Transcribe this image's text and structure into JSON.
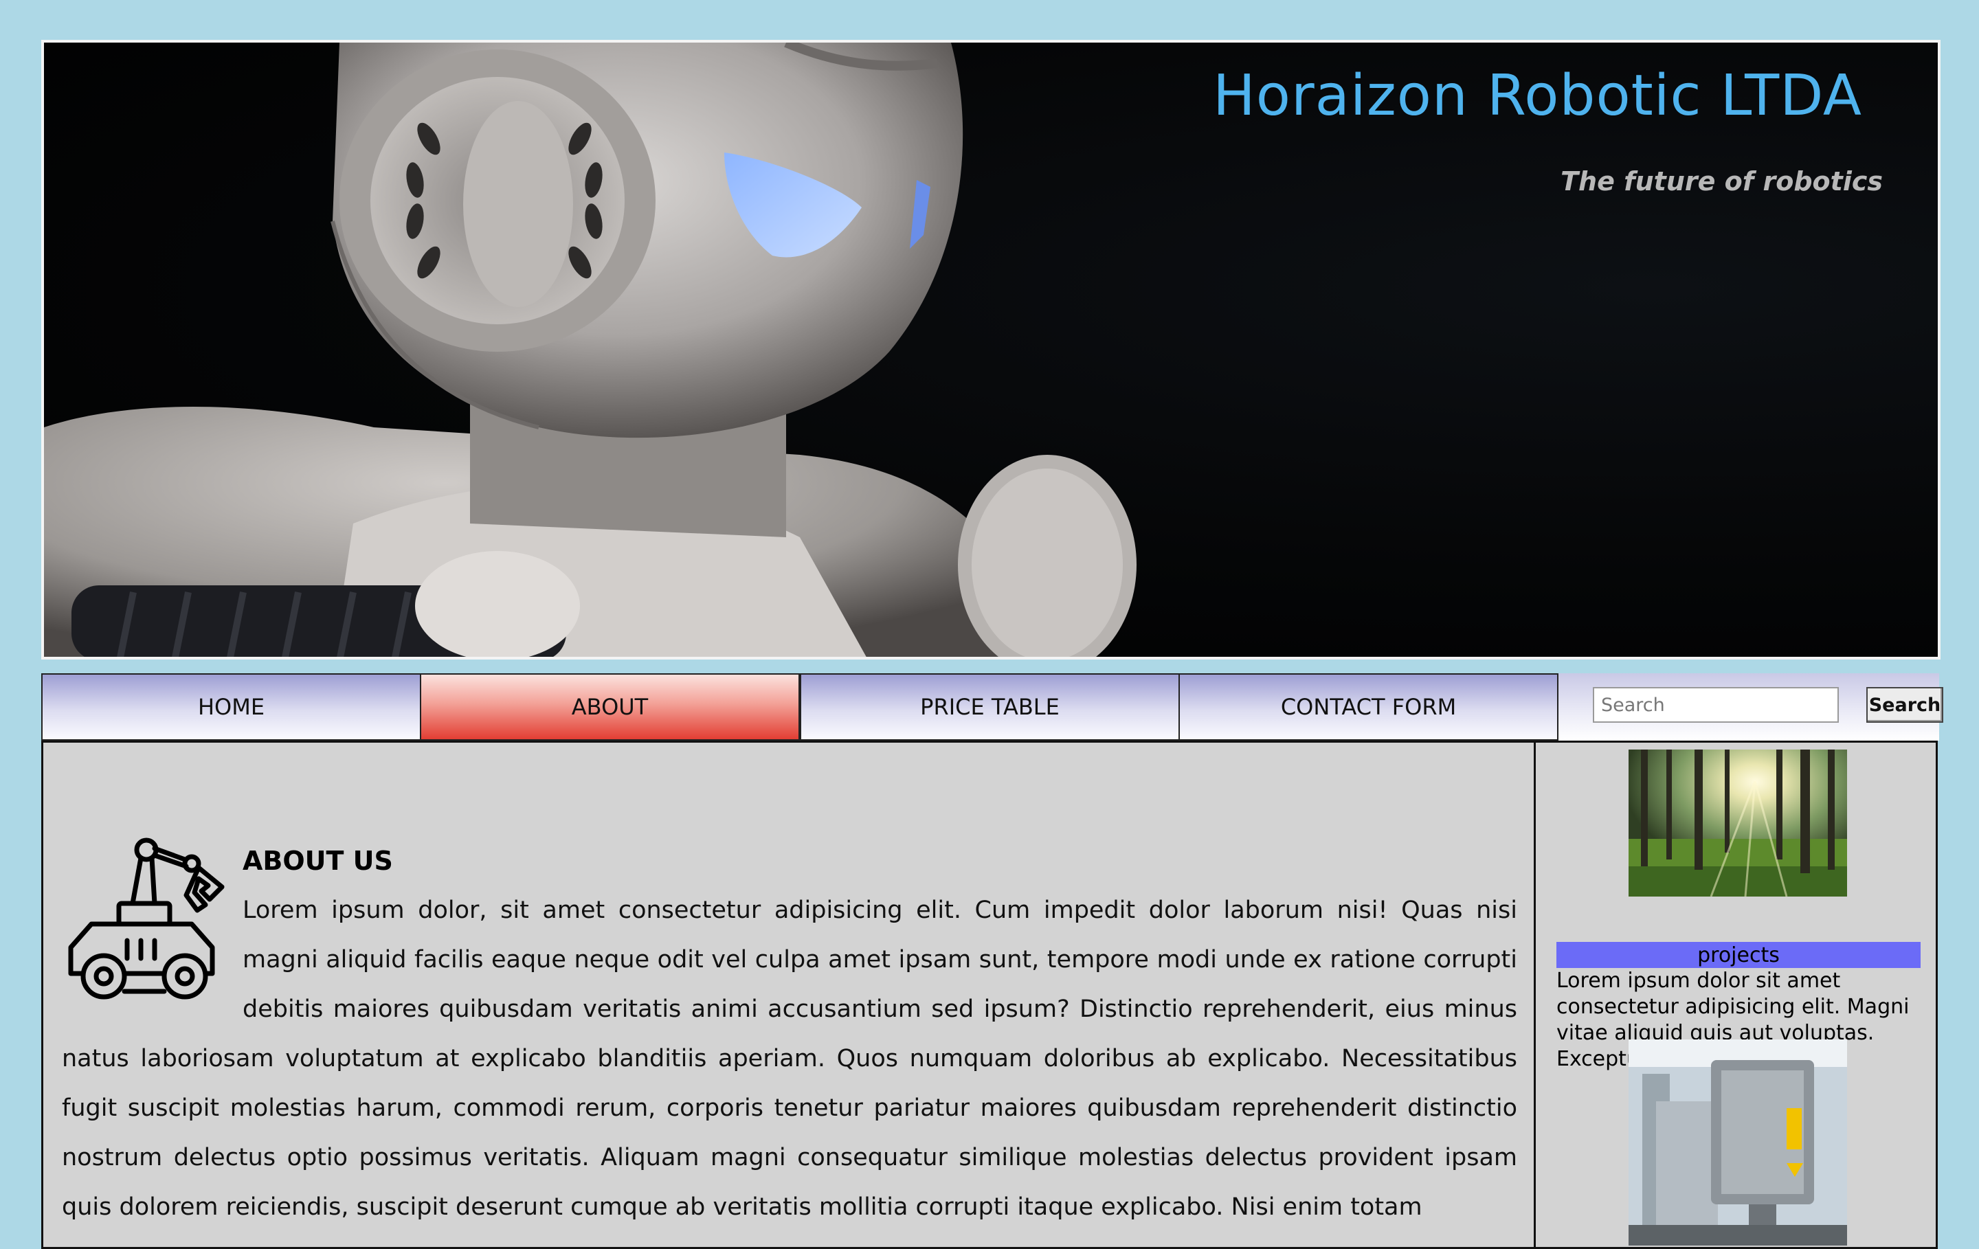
{
  "header": {
    "title": "Horaizon Robotic LTDA",
    "subtitle": "The future of robotics",
    "banner_image": "white-humanoid-robot-photo"
  },
  "nav": {
    "items": [
      {
        "label": "HOME",
        "active": false
      },
      {
        "label": "ABOUT",
        "active": true
      },
      {
        "label": "PRICE TABLE",
        "active": false
      },
      {
        "label": "CONTACT FORM",
        "active": false
      }
    ],
    "search": {
      "placeholder": "Search",
      "button_label": "Search"
    }
  },
  "main": {
    "icon": "robot-rover-arm-icon",
    "heading": "ABOUT US",
    "body": "Lorem ipsum dolor, sit amet consectetur adipisicing elit. Cum impedit dolor laborum nisi! Quas nisi magni aliquid facilis eaque neque odit vel culpa amet ipsam sunt, tempore modi unde ex ratione corrupti debitis maiores quibusdam veritatis animi accusantium sed ipsum? Distinctio reprehenderit, eius minus natus laboriosam voluptatum at explicabo blanditiis aperiam. Quos numquam doloribus ab explicabo. Necessitatibus fugit suscipit molestias harum, commodi rerum, corporis tenetur pariatur maiores quibusdam reprehenderit distinctio nostrum delectus optio possimus veritatis. Aliquam magni consequatur similique molestias delectus provident ipsam quis dolorem reiciendis, suscipit deserunt cumque ab veritatis mollitia corrupti itaque explicabo. Nisi enim totam"
  },
  "sidebar": {
    "image1": "sunlit-forest-photo",
    "label": "projects",
    "text": "Lorem ipsum dolor sit amet consectetur adipisicing elit. Magni vitae aliquid quis aut voluptas. Excepturi!",
    "image2": "cnc-laser-machine-photo"
  },
  "colors": {
    "page_bg": "#add8e6",
    "title": "#4fb3ee",
    "active_tab": "#e23e33",
    "projects_label": "#6b6bf7",
    "content_bg": "#d3d3d3"
  }
}
